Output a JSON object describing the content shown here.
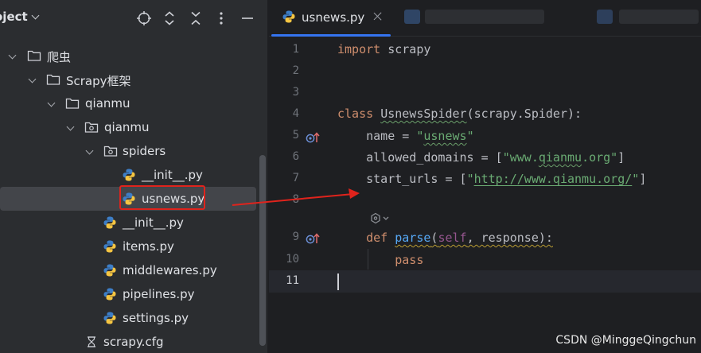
{
  "project_panel": {
    "title": "oject",
    "tree": [
      {
        "label": "爬虫",
        "type": "folder",
        "depth": 0
      },
      {
        "label": "Scrapy框架",
        "type": "folder",
        "depth": 1
      },
      {
        "label": "qianmu",
        "type": "folder",
        "depth": 2
      },
      {
        "label": "qianmu",
        "type": "package",
        "depth": 3
      },
      {
        "label": "spiders",
        "type": "package",
        "depth": 4
      },
      {
        "label": "__init__.py",
        "type": "python",
        "depth": 5
      },
      {
        "label": "usnews.py",
        "type": "python",
        "depth": 5,
        "selected": true
      },
      {
        "label": "__init__.py",
        "type": "python",
        "depth": 4
      },
      {
        "label": "items.py",
        "type": "python",
        "depth": 4
      },
      {
        "label": "middlewares.py",
        "type": "python",
        "depth": 4
      },
      {
        "label": "pipelines.py",
        "type": "python",
        "depth": 4
      },
      {
        "label": "settings.py",
        "type": "python",
        "depth": 4
      },
      {
        "label": "scrapy.cfg",
        "type": "config",
        "depth": 3
      }
    ]
  },
  "editor": {
    "active_tab": "usnews.py",
    "line_numbers": [
      "1",
      "2",
      "3",
      "4",
      "5",
      "6",
      "7",
      "8",
      "9",
      "10",
      "11"
    ],
    "current_line": "11",
    "code": {
      "l1_kw": "import",
      "l1_rest": " scrapy",
      "l4_kw": "class",
      "l4_name": "UsnewsSpider",
      "l4_rest": "(scrapy.Spider):",
      "l5_a": "    name = ",
      "l5_q1": "\"",
      "l5_val": "usnews",
      "l5_q2": "\"",
      "l6_a": "    allowed_domains = [",
      "l6_q1": "\"www.",
      "l6_val": "qianmu",
      "l6_q2": ".org\"",
      "l6_b": "]",
      "l7_a": "    start_urls = [",
      "l7_q1": "\"",
      "l7_val": "http://www.qianmu.org/",
      "l7_q2": "\"",
      "l7_b": "]",
      "l9_ind": "    ",
      "l9_kw": "def",
      "l9_sp": " ",
      "l9_fn": "parse",
      "l9_p1": "(",
      "l9_self": "self",
      "l9_p2": ", response):",
      "l10_ind": "        ",
      "l10_kw": "pass"
    }
  },
  "watermark": "CSDN @MinggeQingchun",
  "colors": {
    "accent": "#3574f0",
    "highlight_red": "#e0231c",
    "keyword": "#cf8e6d",
    "string": "#6aab73",
    "function": "#56a8f5"
  }
}
